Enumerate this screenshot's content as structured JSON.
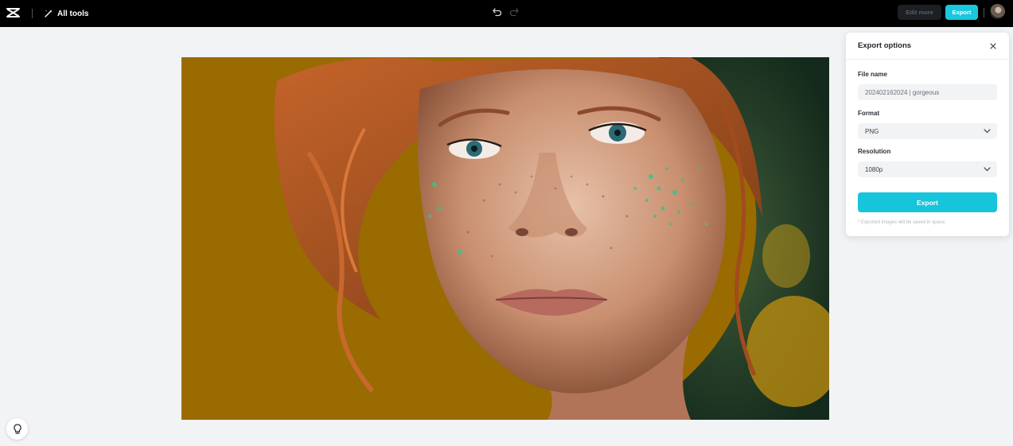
{
  "topbar": {
    "logo_icon": "capcut-logo-icon",
    "all_tools_label": "All tools",
    "undo_icon": "undo-icon",
    "redo_icon": "redo-icon",
    "edit_more_label": "Edit more",
    "export_label": "Export"
  },
  "canvas": {
    "image_description_icon": "portrait-image",
    "background_color": "#996b00"
  },
  "export_panel": {
    "title": "Export options",
    "file_name_label": "File name",
    "file_name_value": "202402162024 | gorgeous",
    "format_label": "Format",
    "format_value": "PNG",
    "resolution_label": "Resolution",
    "resolution_value": "1080p",
    "export_button_label": "Export",
    "note": "* Exported images will be saved in space."
  },
  "colors": {
    "accent": "#19c7de",
    "topbar": "#000000",
    "canvas_bg": "#f1f3f5"
  }
}
